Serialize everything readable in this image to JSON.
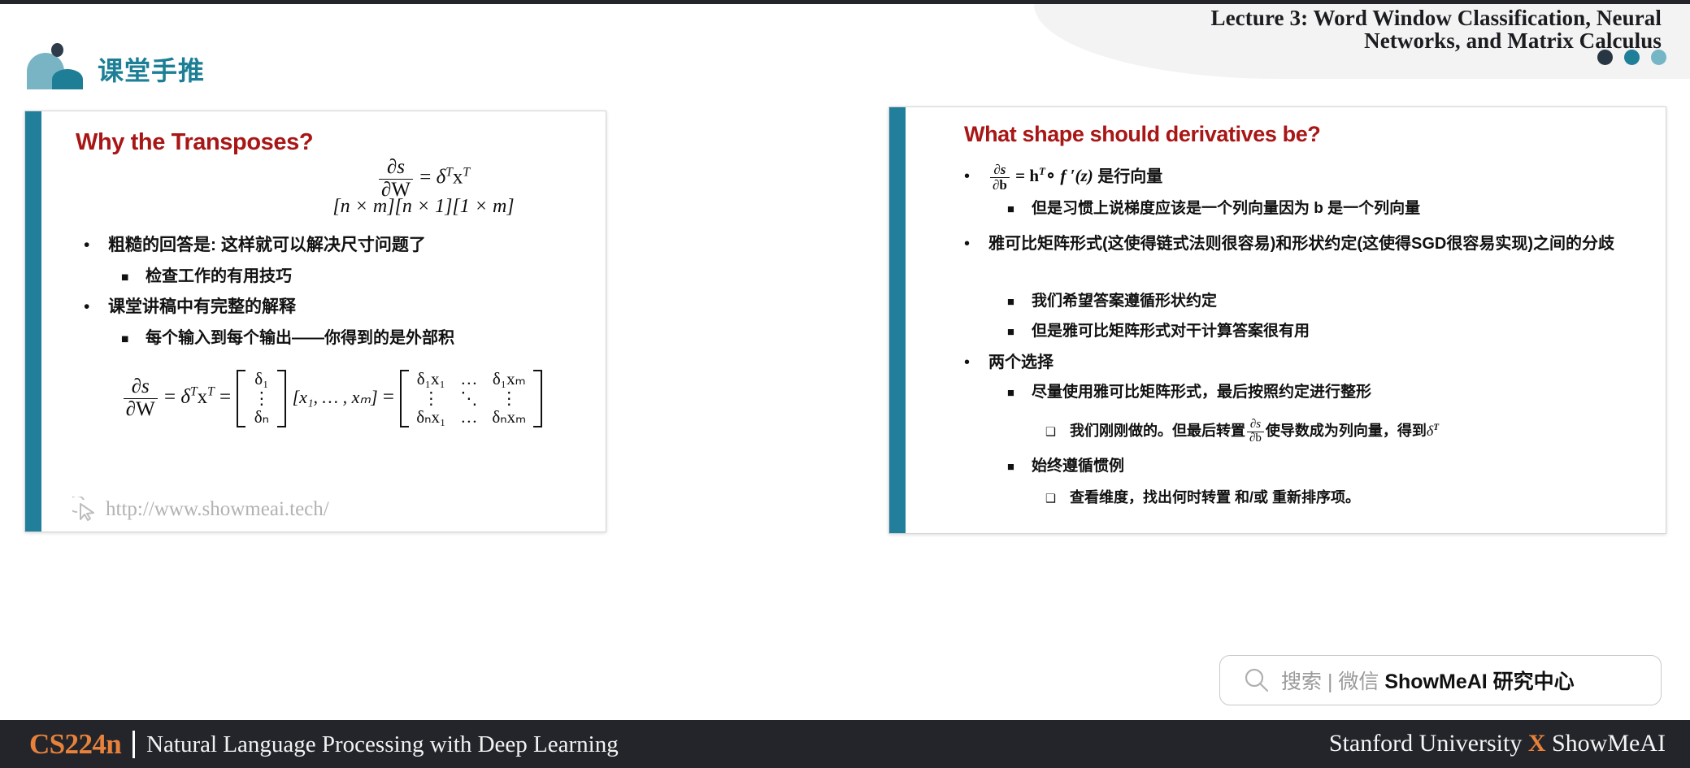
{
  "header": {
    "title": "Lecture 3:  Word Window Classification, Neural\nNetworks, and Matrix Calculus",
    "dots": [
      "#283644",
      "#1f7e98",
      "#74b5c6"
    ]
  },
  "brand": {
    "title": "课堂手推",
    "logo_icon": "showmeai-logo-icon",
    "color": "#1c7f96"
  },
  "left_card": {
    "title": "Why the Transposes?",
    "accent_color": "#227f9c",
    "equation_1": {
      "lhs_num": "∂s",
      "lhs_den": "∂W",
      "eq": "=",
      "rhs": "δ",
      "rhs_sup": "T",
      "rhs2": "x",
      "rhs2_sup": "T"
    },
    "dims": "[n × m][n × 1][1 × m]",
    "bullets": [
      {
        "level": 1,
        "marker": "•",
        "text": "粗糙的回答是: 这样就可以解决尺寸问题了"
      },
      {
        "level": 2,
        "marker": "■",
        "text": "检查工作的有用技巧"
      },
      {
        "level": 1,
        "marker": "•",
        "text": "课堂讲稿中有完整的解释"
      },
      {
        "level": 2,
        "marker": "■",
        "text": "每个输入到每个输出——你得到的是外部积"
      }
    ],
    "big_equation": {
      "lhs_num": "∂s",
      "lhs_den": "∂W",
      "delta": "δ",
      "x": "x",
      "sup_T": "T",
      "col_vector": [
        "δ₁",
        "⋮",
        "δₙ"
      ],
      "row_vector": "[x₁, … , xₘ]",
      "result_matrix": [
        [
          "δ₁x₁",
          "…",
          "δ₁xₘ"
        ],
        [
          "⋮",
          "⋱",
          "⋮"
        ],
        [
          "δₙx₁",
          "…",
          "δₙxₘ"
        ]
      ]
    },
    "watermark": {
      "icon": "cursor-pointer-icon",
      "url": "http://www.showmeai.tech/"
    }
  },
  "right_card": {
    "title": "What shape should derivatives be?",
    "accent_color": "#227f9c",
    "bullets": [
      {
        "level": 1,
        "marker": "•",
        "math_prefix": true,
        "text": "是行向量",
        "formula": {
          "num": "∂s",
          "den": "∂b",
          "rhs": "h",
          "sup": "T",
          "op": "∘",
          "fn": "f ′(z)"
        }
      },
      {
        "level": 2,
        "marker": "■",
        "text": "但是习惯上说梯度应该是一个列向量因为 b 是一个列向量"
      },
      {
        "level": 1,
        "marker": "•",
        "text": "雅可比矩阵形式(这使得链式法则很容易)和形状约定(这使得SGD很容易实现)之间的分歧"
      },
      {
        "level": 2,
        "marker": "■",
        "text": "我们希望答案遵循形状约定"
      },
      {
        "level": 2,
        "marker": "■",
        "text": "但是雅可比矩阵形式对干计算答案很有用"
      },
      {
        "level": 1,
        "marker": "•",
        "text": "两个选择"
      },
      {
        "level": 2,
        "marker": "■",
        "text": "尽量使用雅可比矩阵形式，最后按照约定进行整形"
      },
      {
        "level": 3,
        "marker": "❑",
        "text_before": "我们刚刚做的。但最后转置",
        "frac_num": "∂s",
        "frac_den": "∂b",
        "text_after": "使导数成为列向量，得到",
        "tail_sym": "δ",
        "tail_sup": "T"
      },
      {
        "level": 2,
        "marker": "■",
        "text": "始终遵循惯例"
      },
      {
        "level": 3,
        "marker": "❑",
        "text": "查看维度，找出何时转置 和/或 重新排序项。"
      }
    ]
  },
  "search_badge": {
    "icon": "search-icon",
    "label_gray": "搜索 | 微信 ",
    "label_bold": "ShowMeAI 研究中心"
  },
  "footer": {
    "course_code": "CS224n",
    "course_name": "Natural Language Processing with Deep Learning",
    "right_prefix": "Stanford University ",
    "right_x": "X",
    "right_suffix": " ShowMeAI",
    "accent_color": "#e8813a",
    "background": "#23252b"
  }
}
